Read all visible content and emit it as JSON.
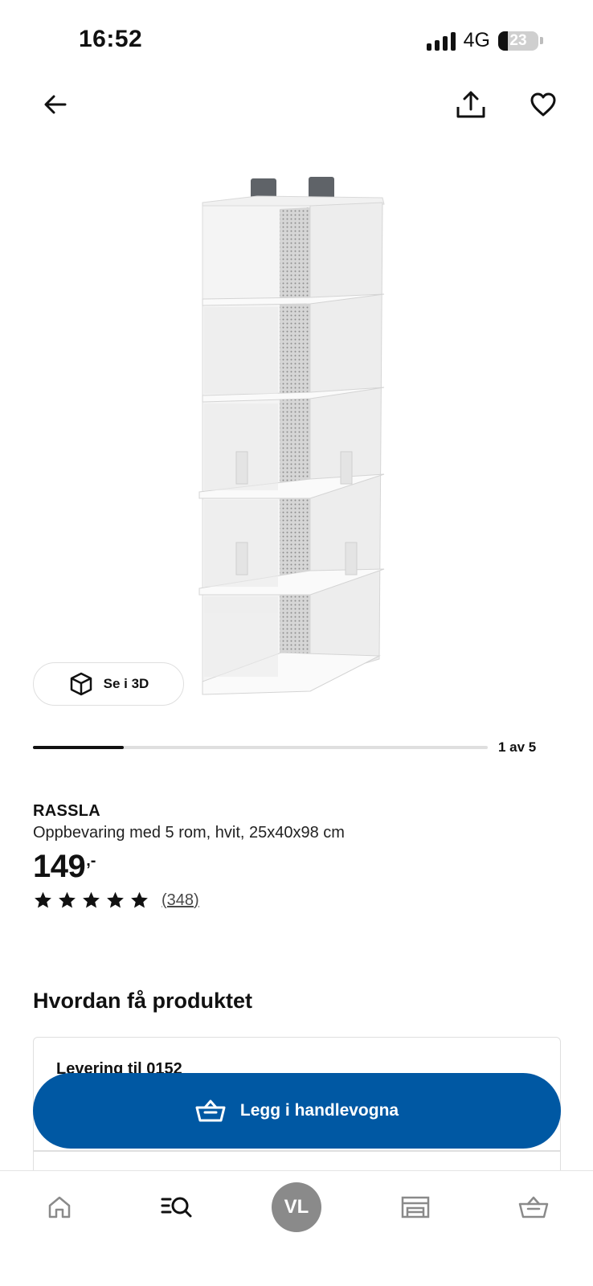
{
  "status_bar": {
    "time": "16:52",
    "network": "4G",
    "battery_level": "23",
    "battery_fraction": 0.23
  },
  "nav": {
    "back_icon": "arrow-left-icon",
    "share_icon": "share-icon",
    "favorite_icon": "heart-icon"
  },
  "gallery": {
    "view_3d_label": "Se i 3D",
    "counter": "1 av 5",
    "current_index": 1,
    "total_images": 5
  },
  "product": {
    "name": "RASSLA",
    "description": "Oppbevaring med 5 rom, hvit, 25x40x98 cm",
    "price": "149",
    "price_suffix": ",-",
    "rating_stars": 5,
    "review_count": "(348)"
  },
  "delivery": {
    "section_title": "Hvordan få produktet",
    "delivery_label": "Levering til 0152"
  },
  "cta": {
    "label": "Legg i handlevogna",
    "icon": "shopping-basket-icon",
    "color": "#0058a3"
  },
  "tabbar": {
    "items": [
      {
        "name": "home",
        "icon": "home-icon"
      },
      {
        "name": "search",
        "icon": "search-list-icon",
        "active": true
      },
      {
        "name": "profile",
        "initials": "VL"
      },
      {
        "name": "stores",
        "icon": "store-icon"
      },
      {
        "name": "cart",
        "icon": "shopping-basket-icon"
      }
    ]
  },
  "colors": {
    "accent": "#0058a3",
    "text": "#111111",
    "divider": "#dfdfdf",
    "avatar": "#8a8a8a"
  }
}
